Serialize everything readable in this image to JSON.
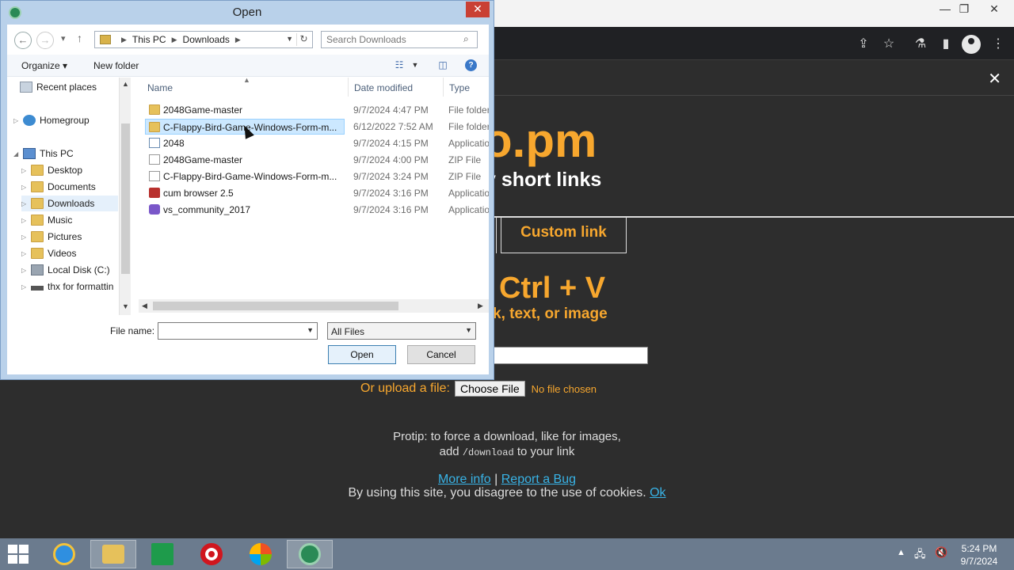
{
  "dialog": {
    "title": "Open",
    "breadcrumb": [
      "This PC",
      "Downloads"
    ],
    "search_placeholder": "Search Downloads",
    "toolbar": {
      "organize": "Organize ▾",
      "new_folder": "New folder"
    },
    "nav": [
      {
        "label": "Recent places",
        "icon": "recent"
      },
      {
        "label": "Homegroup",
        "icon": "homegroup"
      },
      {
        "label": "This PC",
        "icon": "pc"
      },
      {
        "label": "Desktop",
        "icon": "folder"
      },
      {
        "label": "Documents",
        "icon": "folder"
      },
      {
        "label": "Downloads",
        "icon": "folder",
        "selected": true
      },
      {
        "label": "Music",
        "icon": "folder"
      },
      {
        "label": "Pictures",
        "icon": "folder"
      },
      {
        "label": "Videos",
        "icon": "folder"
      },
      {
        "label": "Local Disk (C:)",
        "icon": "disk"
      },
      {
        "label": "thx for formattin",
        "icon": "usb"
      }
    ],
    "columns": {
      "name": "Name",
      "date": "Date modified",
      "type": "Type"
    },
    "files": [
      {
        "name": "2048Game-master",
        "date": "9/7/2024 4:47 PM",
        "type": "File folder",
        "icon": "folder"
      },
      {
        "name": "C-Flappy-Bird-Game-Windows-Form-m...",
        "date": "6/12/2022 7:52 AM",
        "type": "File folder",
        "icon": "folder",
        "selected": true
      },
      {
        "name": "2048",
        "date": "9/7/2024 4:15 PM",
        "type": "Applicatio",
        "icon": "app"
      },
      {
        "name": "2048Game-master",
        "date": "9/7/2024 4:00 PM",
        "type": "ZIP File",
        "icon": "zip"
      },
      {
        "name": "C-Flappy-Bird-Game-Windows-Form-m...",
        "date": "9/7/2024 3:24 PM",
        "type": "ZIP File",
        "icon": "zip"
      },
      {
        "name": "cum browser 2.5",
        "date": "9/7/2024 3:16 PM",
        "type": "Applicatio",
        "icon": "red-app"
      },
      {
        "name": "vs_community_2017",
        "date": "9/7/2024 3:16 PM",
        "type": "Applicatio",
        "icon": "vs"
      }
    ],
    "file_name_label": "File name:",
    "file_name_value": "",
    "file_type": "All Files",
    "open_button": "Open",
    "cancel_button": "Cancel"
  },
  "site": {
    "logo_fragment": "o.pm",
    "tagline_fragment": "y short links",
    "tab_custom": "Custom link",
    "paste_title": "Ctrl + V",
    "paste_sub": "k, text, or image",
    "upload_label": "Or upload a file:",
    "choose_file": "Choose File",
    "no_file": "No file chosen",
    "protip_line1": "Protip: to force a download, like for images,",
    "protip_add": "add",
    "protip_code": "/download",
    "protip_tail": "to your link",
    "more_info": "More info",
    "pipe": "|",
    "report_bug": "Report a Bug",
    "cookies": "By using this site, you disagree to the use of cookies.",
    "ok": "Ok"
  },
  "taskbar": {
    "time": "5:24 PM",
    "date": "9/7/2024",
    "apps": [
      "internet-explorer",
      "file-explorer",
      "store",
      "opera",
      "windows-live",
      "app-globe"
    ]
  },
  "colors": {
    "accent_orange": "#f7a72e",
    "link_blue": "#38b3e6",
    "dialog_frame": "#b9d1ea",
    "selection": "#cce8ff"
  }
}
